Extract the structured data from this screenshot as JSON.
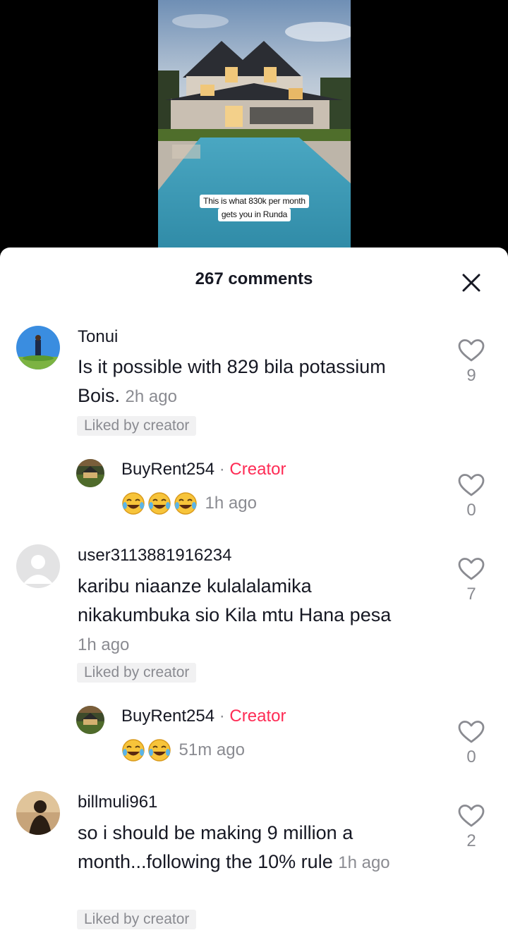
{
  "video": {
    "caption_line1": "This is what 830k per month",
    "caption_line2": "gets you in Runda"
  },
  "header": {
    "count_label": "267 comments"
  },
  "comments": [
    {
      "username": "Tonui",
      "text": "Is it possible with 829 bila potassium Bois.",
      "time": "2h ago",
      "liked_by_creator": "Liked by creator",
      "likes": "9"
    },
    {
      "username": "BuyRent254",
      "creator_sep": " · ",
      "creator": "Creator",
      "emoji_count": 3,
      "time": "1h ago",
      "likes": "0"
    },
    {
      "username": "user3113881916234",
      "text": "karibu niaanze kulalalamika nikakumbuka sio Kila mtu Hana pesa",
      "time": "1h ago",
      "liked_by_creator": "Liked by creator",
      "likes": "7"
    },
    {
      "username": "BuyRent254",
      "creator_sep": " · ",
      "creator": "Creator",
      "emoji_count": 2,
      "time": "51m ago",
      "likes": "0"
    },
    {
      "username": "billmuli961",
      "text": "so i should be making 9 million a month...following the 10% rule",
      "time": "1h ago",
      "liked_by_creator": "Liked by creator",
      "likes": "2"
    }
  ],
  "colors": {
    "creator_accent": "#fe2c55",
    "muted": "#8a8b91",
    "text": "#161823"
  },
  "icons": {
    "close": "close-icon",
    "like": "heart-outline-icon",
    "emoji": "tears-of-joy-emoji-icon"
  }
}
